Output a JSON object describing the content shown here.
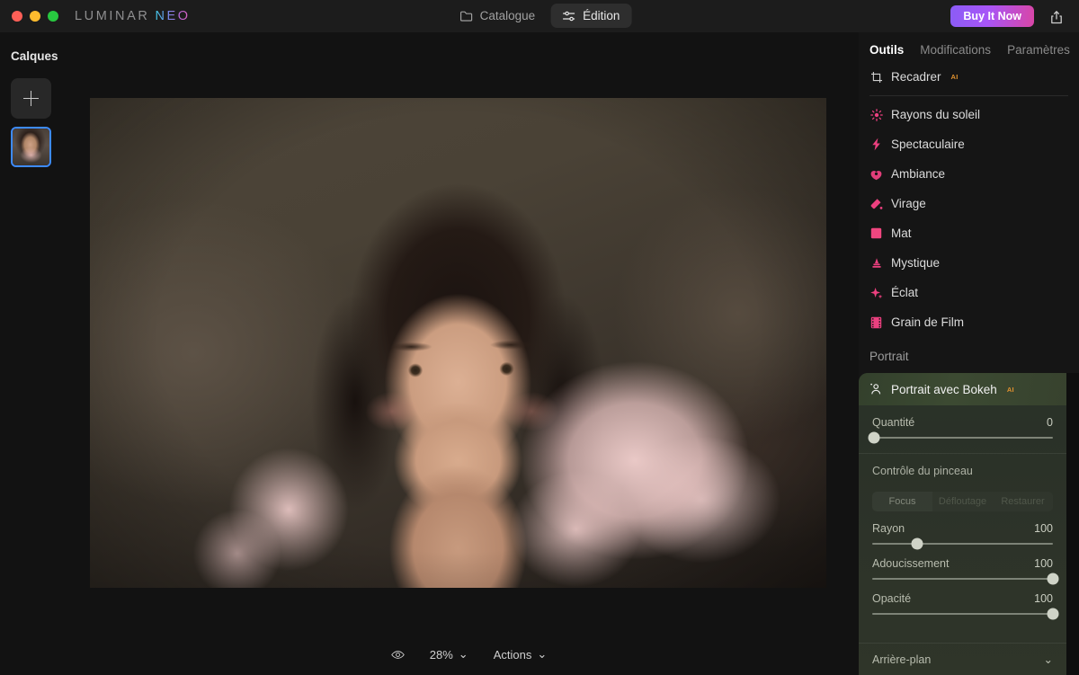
{
  "titlebar": {
    "brand_first": "LUMINAR",
    "brand_second": "NEO",
    "tabs": [
      {
        "label": "Catalogue",
        "icon": "folder-icon",
        "active": false
      },
      {
        "label": "Édition",
        "icon": "sliders-icon",
        "active": true
      }
    ],
    "buy_label": "Buy It Now",
    "share_icon": "share-icon",
    "accent_gradient_start": "#8b5cf6",
    "accent_gradient_end": "#d946a6"
  },
  "left_panel": {
    "title": "Calques",
    "add_layer_icon": "plus-icon",
    "layer_selected_color": "#3d8bfd"
  },
  "canvas": {
    "bottom_bar": {
      "preview_icon": "eye-icon",
      "zoom_level": "28%",
      "actions_label": "Actions",
      "chevron": "⌄"
    }
  },
  "right_panel": {
    "tabs": [
      {
        "label": "Outils",
        "active": true
      },
      {
        "label": "Modifications",
        "active": false
      },
      {
        "label": "Paramètres",
        "active": false
      }
    ],
    "pinned_tool": {
      "label": "Recadrer",
      "icon": "crop-icon",
      "ai": "AI"
    },
    "tools": [
      {
        "label": "Rayons du soleil",
        "icon": "sun-rays-icon"
      },
      {
        "label": "Spectaculaire",
        "icon": "bolt-icon"
      },
      {
        "label": "Ambiance",
        "icon": "mood-icon"
      },
      {
        "label": "Virage",
        "icon": "color-cast-icon"
      },
      {
        "label": "Mat",
        "icon": "matte-icon"
      },
      {
        "label": "Mystique",
        "icon": "mystical-icon"
      },
      {
        "label": "Éclat",
        "icon": "glow-icon"
      },
      {
        "label": "Grain de Film",
        "icon": "film-grain-icon"
      }
    ],
    "section_title": "Portrait",
    "icon_color": "#ec407f",
    "active_tool": {
      "title": "Portrait avec Bokeh",
      "icon": "portrait-bokeh-icon",
      "ai": "AI",
      "amount": {
        "label": "Quantité",
        "value": "0",
        "percent": 0
      },
      "brush_title": "Contrôle du pinceau",
      "brush_modes": [
        {
          "label": "Focus",
          "active": true
        },
        {
          "label": "Défloutage",
          "active": false
        },
        {
          "label": "Restaurer",
          "active": false
        }
      ],
      "sliders": [
        {
          "label": "Rayon",
          "value": "100",
          "percent": 25
        },
        {
          "label": "Adoucissement",
          "value": "100",
          "percent": 100
        },
        {
          "label": "Opacité",
          "value": "100",
          "percent": 100
        }
      ],
      "footer": {
        "label": "Arrière-plan",
        "chevron": "⌄"
      }
    }
  }
}
